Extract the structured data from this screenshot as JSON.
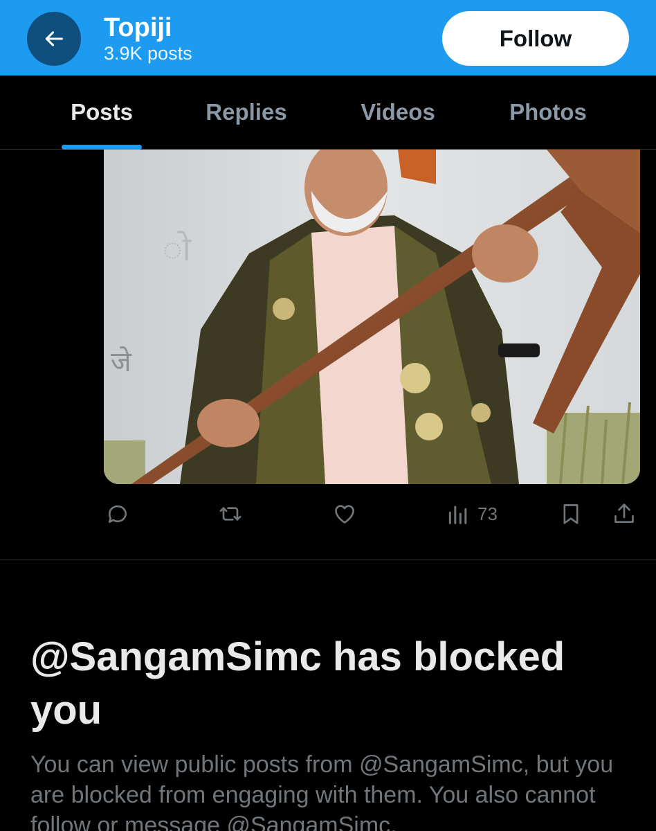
{
  "header": {
    "profile_name": "Topiji",
    "post_count": "3.9K posts",
    "follow_label": "Follow",
    "back_icon": "arrow-left-icon",
    "background_color": "#1d9bf0"
  },
  "tabs": [
    {
      "label": "Posts",
      "active": true
    },
    {
      "label": "Replies",
      "active": false
    },
    {
      "label": "Videos",
      "active": false
    },
    {
      "label": "Photos",
      "active": false
    }
  ],
  "post": {
    "media_description_icon": "photo-image",
    "views": "73",
    "actions": [
      "reply-icon",
      "repost-icon",
      "like-icon",
      "views-icon",
      "bookmark-icon",
      "share-icon"
    ]
  },
  "blocked": {
    "title": "@SangamSimc has blocked you",
    "body": "You can view public posts from @SangamSimc, but you are blocked from engaging with them. You also cannot follow or message @SangamSimc."
  },
  "colors": {
    "accent": "#1d9bf0",
    "background": "#000000",
    "text_primary": "#e7e9ea",
    "text_secondary": "#71767b"
  }
}
